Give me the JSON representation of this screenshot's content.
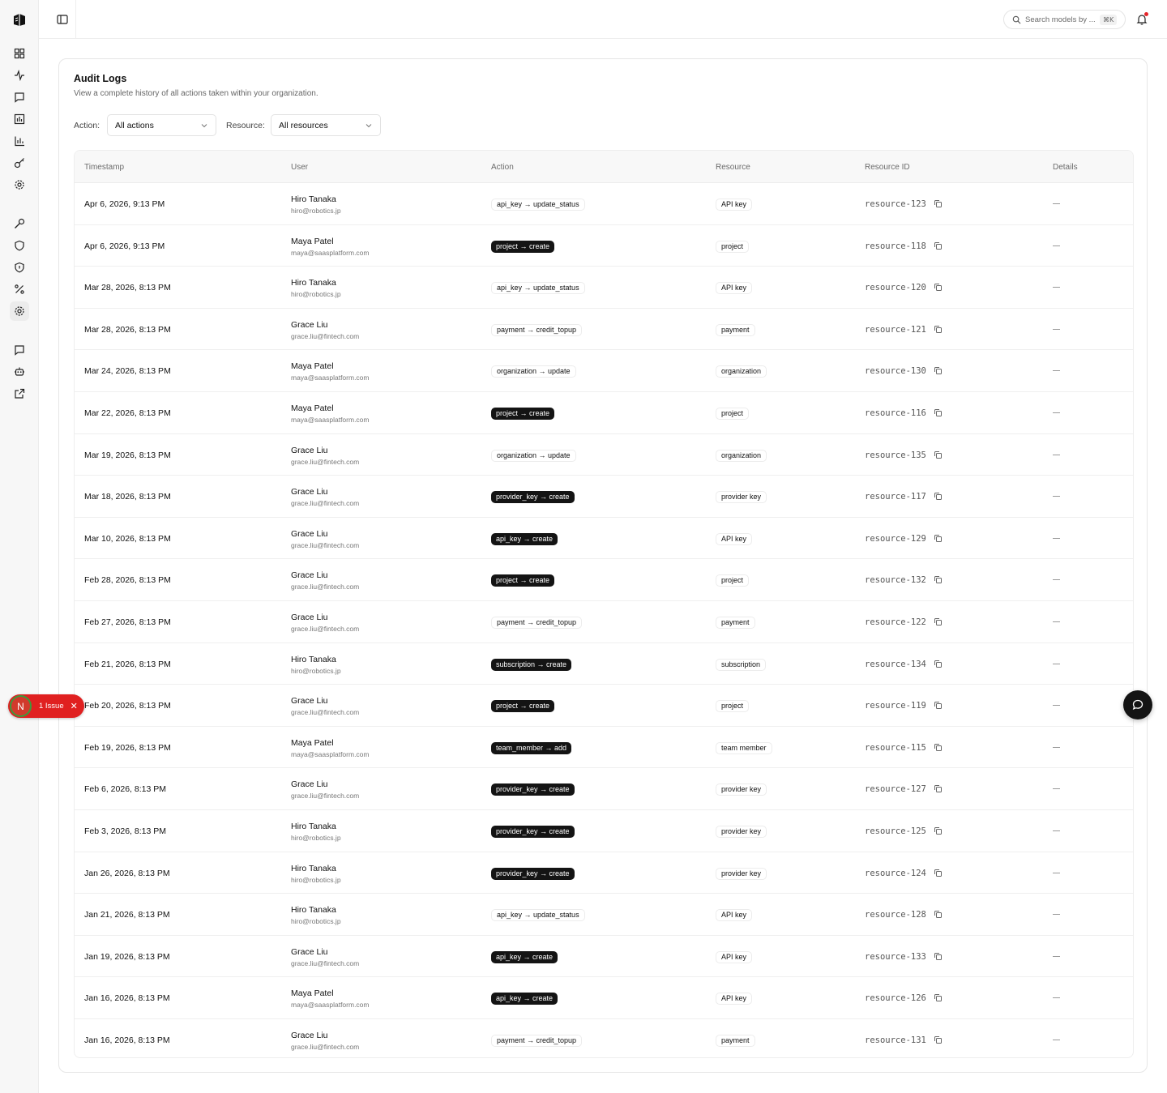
{
  "sidebar": {
    "icons": [
      "logo-icon",
      "dashboard-icon",
      "activity-icon",
      "chat-icon",
      "usage-icon",
      "chart-icon",
      "key-icon",
      "settings-icon",
      "tool-icon",
      "shield-icon",
      "security-icon",
      "percent-icon",
      "org-settings-icon",
      "feedback-icon",
      "bot-icon",
      "external-link-icon"
    ]
  },
  "topbar": {
    "search_placeholder": "Search models by ...",
    "search_shortcut": "⌘K"
  },
  "page": {
    "title": "Audit Logs",
    "description": "View a complete history of all actions taken within your organization."
  },
  "filters": {
    "action_label": "Action:",
    "action_value": "All actions",
    "resource_label": "Resource:",
    "resource_value": "All resources"
  },
  "table": {
    "columns": [
      "Timestamp",
      "User",
      "Action",
      "Resource",
      "Resource ID",
      "Details"
    ],
    "rows": [
      {
        "timestamp": "Apr 6, 2026, 9:13 PM",
        "name": "Hiro Tanaka",
        "email": "hiro@robotics.jp",
        "action": "api_key → update_status",
        "action_style": "outline",
        "resource": "API key",
        "resource_id": "resource-123"
      },
      {
        "timestamp": "Apr 6, 2026, 9:13 PM",
        "name": "Maya Patel",
        "email": "maya@saasplatform.com",
        "action": "project → create",
        "action_style": "solid",
        "resource": "project",
        "resource_id": "resource-118"
      },
      {
        "timestamp": "Mar 28, 2026, 8:13 PM",
        "name": "Hiro Tanaka",
        "email": "hiro@robotics.jp",
        "action": "api_key → update_status",
        "action_style": "outline",
        "resource": "API key",
        "resource_id": "resource-120"
      },
      {
        "timestamp": "Mar 28, 2026, 8:13 PM",
        "name": "Grace Liu",
        "email": "grace.liu@fintech.com",
        "action": "payment → credit_topup",
        "action_style": "outline",
        "resource": "payment",
        "resource_id": "resource-121"
      },
      {
        "timestamp": "Mar 24, 2026, 8:13 PM",
        "name": "Maya Patel",
        "email": "maya@saasplatform.com",
        "action": "organization → update",
        "action_style": "outline",
        "resource": "organization",
        "resource_id": "resource-130"
      },
      {
        "timestamp": "Mar 22, 2026, 8:13 PM",
        "name": "Maya Patel",
        "email": "maya@saasplatform.com",
        "action": "project → create",
        "action_style": "solid",
        "resource": "project",
        "resource_id": "resource-116"
      },
      {
        "timestamp": "Mar 19, 2026, 8:13 PM",
        "name": "Grace Liu",
        "email": "grace.liu@fintech.com",
        "action": "organization → update",
        "action_style": "outline",
        "resource": "organization",
        "resource_id": "resource-135"
      },
      {
        "timestamp": "Mar 18, 2026, 8:13 PM",
        "name": "Grace Liu",
        "email": "grace.liu@fintech.com",
        "action": "provider_key → create",
        "action_style": "solid",
        "resource": "provider key",
        "resource_id": "resource-117"
      },
      {
        "timestamp": "Mar 10, 2026, 8:13 PM",
        "name": "Grace Liu",
        "email": "grace.liu@fintech.com",
        "action": "api_key → create",
        "action_style": "solid",
        "resource": "API key",
        "resource_id": "resource-129"
      },
      {
        "timestamp": "Feb 28, 2026, 8:13 PM",
        "name": "Grace Liu",
        "email": "grace.liu@fintech.com",
        "action": "project → create",
        "action_style": "solid",
        "resource": "project",
        "resource_id": "resource-132"
      },
      {
        "timestamp": "Feb 27, 2026, 8:13 PM",
        "name": "Grace Liu",
        "email": "grace.liu@fintech.com",
        "action": "payment → credit_topup",
        "action_style": "outline",
        "resource": "payment",
        "resource_id": "resource-122"
      },
      {
        "timestamp": "Feb 21, 2026, 8:13 PM",
        "name": "Hiro Tanaka",
        "email": "hiro@robotics.jp",
        "action": "subscription → create",
        "action_style": "solid",
        "resource": "subscription",
        "resource_id": "resource-134"
      },
      {
        "timestamp": "Feb 20, 2026, 8:13 PM",
        "name": "Grace Liu",
        "email": "grace.liu@fintech.com",
        "action": "project → create",
        "action_style": "solid",
        "resource": "project",
        "resource_id": "resource-119"
      },
      {
        "timestamp": "Feb 19, 2026, 8:13 PM",
        "name": "Maya Patel",
        "email": "maya@saasplatform.com",
        "action": "team_member → add",
        "action_style": "solid",
        "resource": "team member",
        "resource_id": "resource-115"
      },
      {
        "timestamp": "Feb 6, 2026, 8:13 PM",
        "name": "Grace Liu",
        "email": "grace.liu@fintech.com",
        "action": "provider_key → create",
        "action_style": "solid",
        "resource": "provider key",
        "resource_id": "resource-127"
      },
      {
        "timestamp": "Feb 3, 2026, 8:13 PM",
        "name": "Hiro Tanaka",
        "email": "hiro@robotics.jp",
        "action": "provider_key → create",
        "action_style": "solid",
        "resource": "provider key",
        "resource_id": "resource-125"
      },
      {
        "timestamp": "Jan 26, 2026, 8:13 PM",
        "name": "Hiro Tanaka",
        "email": "hiro@robotics.jp",
        "action": "provider_key → create",
        "action_style": "solid",
        "resource": "provider key",
        "resource_id": "resource-124"
      },
      {
        "timestamp": "Jan 21, 2026, 8:13 PM",
        "name": "Hiro Tanaka",
        "email": "hiro@robotics.jp",
        "action": "api_key → update_status",
        "action_style": "outline",
        "resource": "API key",
        "resource_id": "resource-128"
      },
      {
        "timestamp": "Jan 19, 2026, 8:13 PM",
        "name": "Grace Liu",
        "email": "grace.liu@fintech.com",
        "action": "api_key → create",
        "action_style": "solid",
        "resource": "API key",
        "resource_id": "resource-133"
      },
      {
        "timestamp": "Jan 16, 2026, 8:13 PM",
        "name": "Maya Patel",
        "email": "maya@saasplatform.com",
        "action": "api_key → create",
        "action_style": "solid",
        "resource": "API key",
        "resource_id": "resource-126"
      },
      {
        "timestamp": "Jan 16, 2026, 8:13 PM",
        "name": "Grace Liu",
        "email": "grace.liu@fintech.com",
        "action": "payment → credit_topup",
        "action_style": "outline",
        "resource": "payment",
        "resource_id": "resource-131"
      }
    ],
    "details_placeholder": "—"
  },
  "issue_badge": {
    "logo_letter": "N",
    "label": "1 Issue",
    "close": "✕"
  },
  "colors": {
    "solid_badge": "#141414",
    "issue_red": "#e02020",
    "notification_dot": "#e5252a"
  }
}
